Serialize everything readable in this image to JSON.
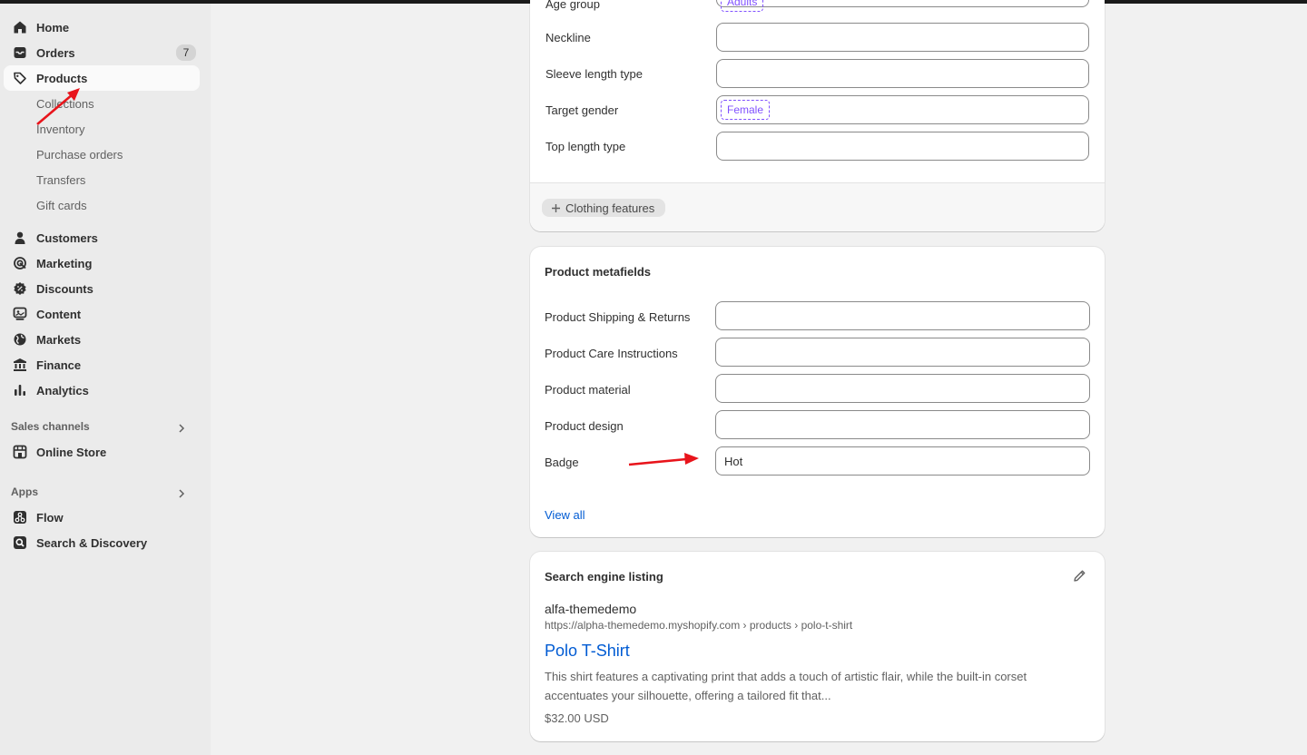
{
  "sidebar": {
    "items": [
      {
        "label": "Home",
        "icon": "home-icon"
      },
      {
        "label": "Orders",
        "icon": "inbox-icon",
        "badge": "7"
      },
      {
        "label": "Products",
        "icon": "tag-icon"
      },
      {
        "label": "Customers",
        "icon": "person-icon"
      },
      {
        "label": "Marketing",
        "icon": "target-icon"
      },
      {
        "label": "Discounts",
        "icon": "discount-icon"
      },
      {
        "label": "Content",
        "icon": "content-icon"
      },
      {
        "label": "Markets",
        "icon": "globe-icon"
      },
      {
        "label": "Finance",
        "icon": "bank-icon"
      },
      {
        "label": "Analytics",
        "icon": "bar-chart-icon"
      }
    ],
    "product_sub_items": [
      "Collections",
      "Inventory",
      "Purchase orders",
      "Transfers",
      "Gift cards"
    ],
    "sales_channels": {
      "title": "Sales channels",
      "items": [
        {
          "label": "Online Store",
          "icon": "store-icon"
        }
      ]
    },
    "apps": {
      "title": "Apps",
      "items": [
        {
          "label": "Flow",
          "icon": "flow-icon"
        },
        {
          "label": "Search & Discovery",
          "icon": "search-discovery-icon"
        }
      ]
    }
  },
  "category_card": {
    "partial_label": "Age group",
    "partial_chip": "Adults",
    "rows": [
      {
        "label": "Neckline",
        "value": ""
      },
      {
        "label": "Sleeve length type",
        "value": ""
      },
      {
        "label": "Target gender",
        "chip": "Female"
      },
      {
        "label": "Top length type",
        "value": ""
      }
    ],
    "add_button": "Clothing features"
  },
  "metafields_card": {
    "title": "Product metafields",
    "rows": [
      {
        "label": "Product Shipping & Returns",
        "value": ""
      },
      {
        "label": "Product Care Instructions",
        "value": ""
      },
      {
        "label": "Product material",
        "value": ""
      },
      {
        "label": "Product design",
        "value": ""
      },
      {
        "label": "Badge",
        "value": "Hot"
      }
    ],
    "view_all": "View all"
  },
  "seo_card": {
    "title": "Search engine listing",
    "store_name": "alfa-themedemo",
    "url": "https://alpha-themedemo.myshopify.com › products › polo-t-shirt",
    "page_title": "Polo T-Shirt",
    "description_line1": "This shirt features a captivating print that adds a touch of artistic flair, while the built-in corset",
    "description_line2": "accentuates your silhouette, offering a tailored fit that...",
    "price": "$32.00 USD"
  },
  "colors": {
    "link": "#005bd3",
    "chip": "#8051ff",
    "annotation_arrow": "#e8141b"
  }
}
